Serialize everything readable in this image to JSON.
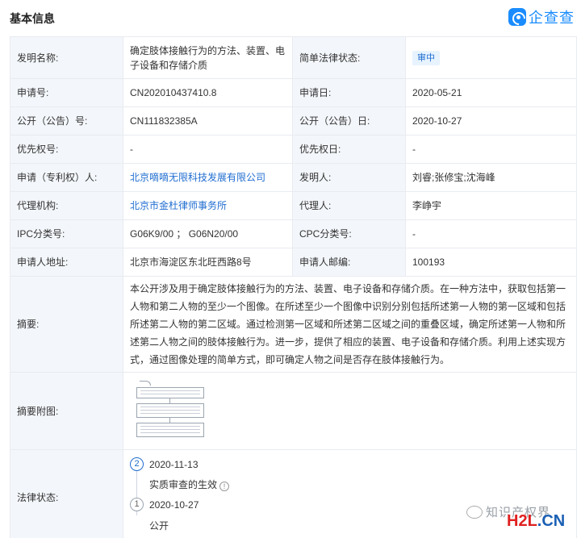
{
  "header": {
    "title": "基本信息",
    "logo_text": "企查查"
  },
  "fields": {
    "invention_name_label": "发明名称:",
    "invention_name": "确定肢体接触行为的方法、装置、电子设备和存储介质",
    "legal_status_brief_label": "简单法律状态:",
    "legal_status_brief": "审中",
    "application_no_label": "申请号:",
    "application_no": "CN202010437410.8",
    "application_date_label": "申请日:",
    "application_date": "2020-05-21",
    "publication_no_label": "公开（公告）号:",
    "publication_no": "CN111832385A",
    "publication_date_label": "公开（公告）日:",
    "publication_date": "2020-10-27",
    "priority_no_label": "优先权号:",
    "priority_no": "-",
    "priority_date_label": "优先权日:",
    "priority_date": "-",
    "applicant_label": "申请（专利权）人:",
    "applicant": "北京嘀嘀无限科技发展有限公司",
    "inventor_label": "发明人:",
    "inventor": "刘睿;张修宝;沈海峰",
    "agency_label": "代理机构:",
    "agency": "北京市金杜律师事务所",
    "agent_label": "代理人:",
    "agent": "李峥宇",
    "ipc_label": "IPC分类号:",
    "ipc": "G06K9/00 ； G06N20/00",
    "cpc_label": "CPC分类号:",
    "cpc": "-",
    "address_label": "申请人地址:",
    "address": "北京市海淀区东北旺西路8号",
    "postcode_label": "申请人邮编:",
    "postcode": "100193",
    "abstract_label": "摘要:",
    "abstract": "本公开涉及用于确定肢体接触行为的方法、装置、电子设备和存储介质。在一种方法中，获取包括第一人物和第二人物的至少一个图像。在所述至少一个图像中识别分别包括所述第一人物的第一区域和包括所述第二人物的第二区域。通过检测第一区域和所述第二区域之间的重叠区域，确定所述第一人物和所述第二人物之间的肢体接触行为。进一步，提供了相应的装置、电子设备和存储介质。利用上述实现方式，通过图像处理的简单方式，即可确定人物之间是否存在肢体接触行为。",
    "abstract_figure_label": "摘要附图:",
    "legal_status_label": "法律状态:"
  },
  "legal_timeline": [
    {
      "index": "2",
      "date": "2020-11-13",
      "event": "实质审查的生效"
    },
    {
      "index": "1",
      "date": "2020-10-27",
      "event": "公开"
    }
  ],
  "watermark": {
    "text": "知识产权界",
    "brand_h2l": "H2L",
    "brand_cn": ".CN"
  },
  "colors": {
    "link": "#1f6dd0",
    "label_bg": "#f3f6fa",
    "border": "#e8ebf0",
    "logo": "#1a8cff"
  }
}
